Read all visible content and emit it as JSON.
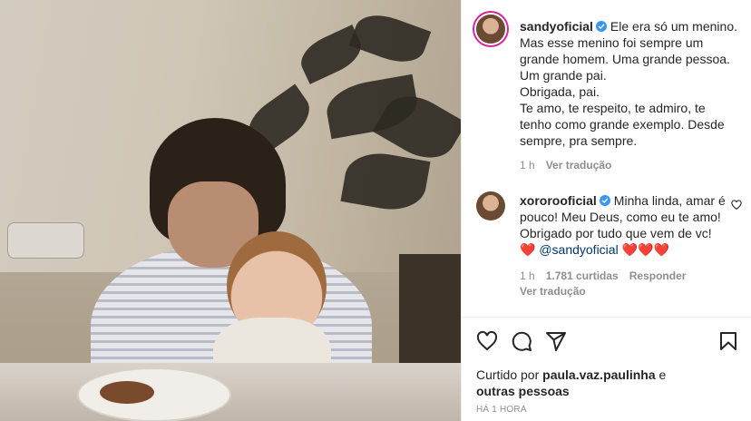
{
  "post": {
    "author": "sandyoficial",
    "caption_lines": [
      "Ele era só um menino.",
      "Mas esse menino foi sempre um",
      "grande homem. Uma grande pessoa.",
      "Um grande pai.",
      "Obrigada, pai.",
      "Te amo, te respeito, te admiro, te",
      "tenho como grande exemplo. Desde",
      "sempre, pra sempre."
    ],
    "time": "1 h",
    "translate": "Ver tradução"
  },
  "comment": {
    "author": "xororooficial",
    "text_line1": "Minha linda, amar é",
    "text_line2": "pouco! Meu Deus, como eu te amo!",
    "text_line3": "Obrigado por tudo que vem de vc!",
    "heart1": "❤️",
    "mention": "@sandyoficial",
    "hearts_after": "❤️❤️❤️",
    "time": "1 h",
    "likes": "1.781 curtidas",
    "reply": "Responder",
    "translate": "Ver tradução"
  },
  "likes": {
    "prefix": "Curtido por ",
    "user": "paula.vaz.paulinha",
    "joiner": " e",
    "others": "outras pessoas"
  },
  "timestamp": "HÁ 1 HORA",
  "icons": {
    "like": "heart-outline-icon",
    "comment": "comment-bubble-icon",
    "share": "paper-plane-icon",
    "save": "bookmark-icon",
    "verified": "verified-badge-icon"
  },
  "colors": {
    "accent_blue": "#3897f0",
    "mention": "#00376b",
    "meta_gray": "#8e8e8e",
    "heart_red": "#ed4956"
  }
}
